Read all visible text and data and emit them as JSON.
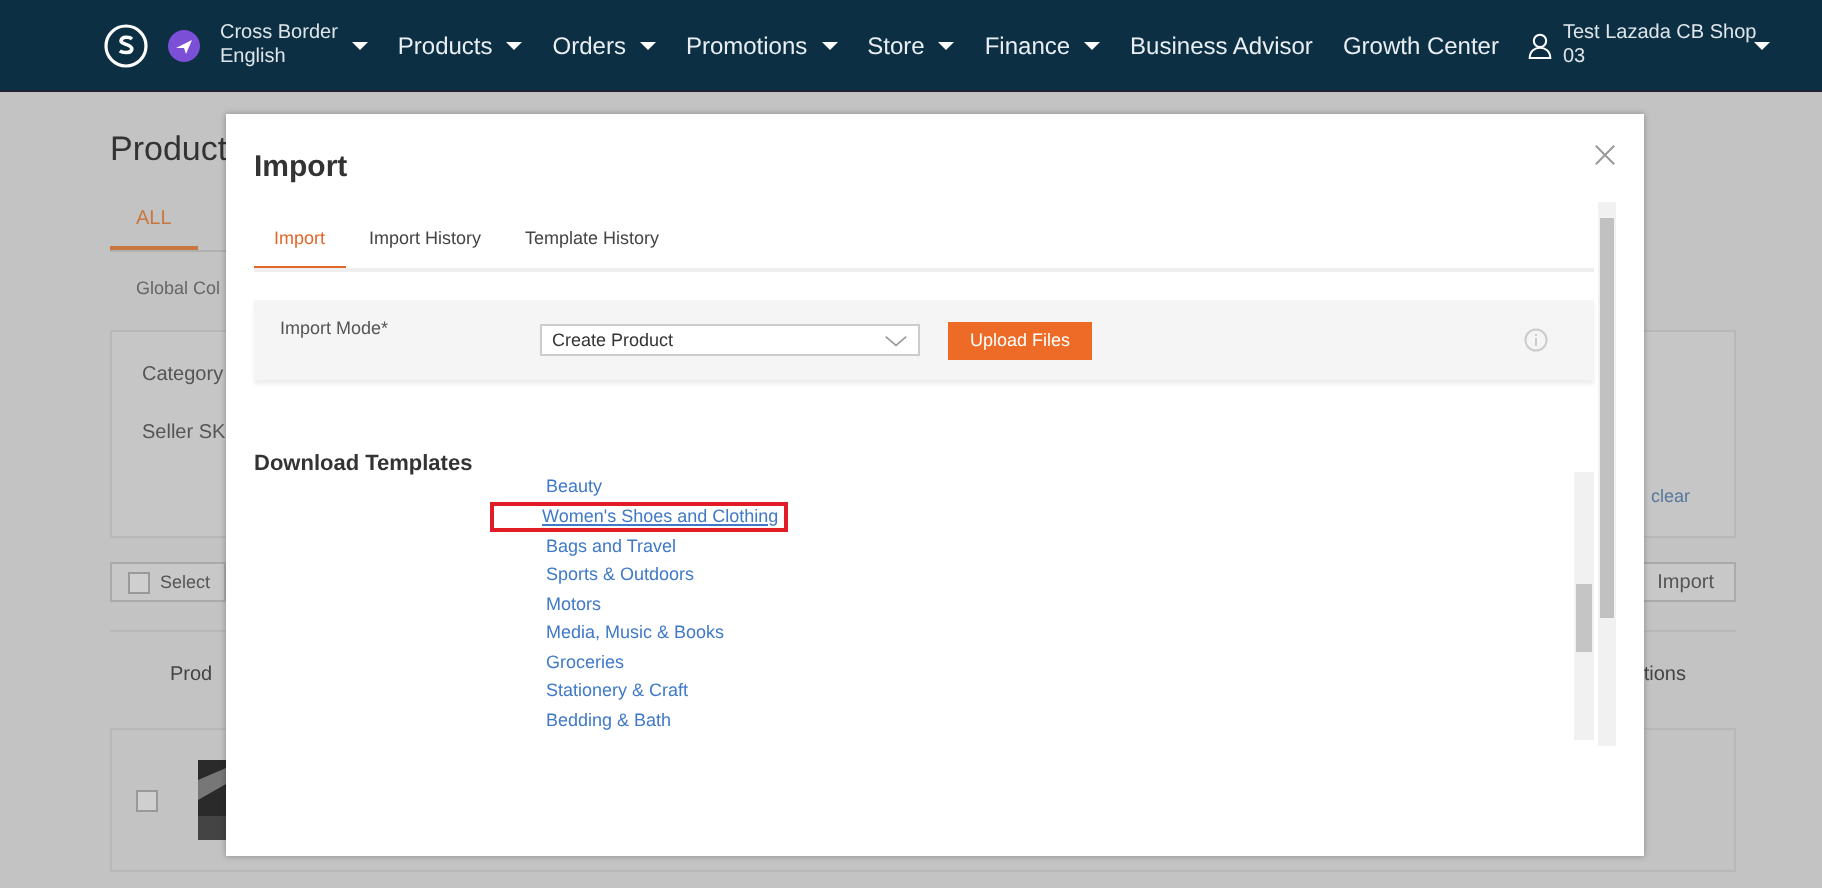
{
  "top_nav": {
    "region": {
      "line1": "Cross Border",
      "line2": "English"
    },
    "items": [
      {
        "label": "Products",
        "has_menu": true
      },
      {
        "label": "Orders",
        "has_menu": true
      },
      {
        "label": "Promotions",
        "has_menu": true
      },
      {
        "label": "Store",
        "has_menu": true
      },
      {
        "label": "Finance",
        "has_menu": true
      },
      {
        "label": "Business Advisor",
        "has_menu": false
      },
      {
        "label": "Growth Center",
        "has_menu": false
      }
    ],
    "account": {
      "line1": "Test Lazada CB Shop",
      "line2": "03"
    }
  },
  "page": {
    "title": "Product",
    "tabs": [
      {
        "label": "ALL",
        "selected": true
      }
    ],
    "subtab": "Global Col",
    "filters": [
      "Category",
      "Seller SK"
    ],
    "clear": "clear",
    "select": {
      "label": "Select",
      "checked": false
    },
    "import": "Import",
    "columns": [
      "Prod",
      "tions"
    ],
    "row": {
      "checked": false
    }
  },
  "dialog": {
    "title": "Import",
    "tabs": [
      {
        "label": "Import",
        "selected": true
      },
      {
        "label": "Import History",
        "selected": false
      },
      {
        "label": "Template History",
        "selected": false
      }
    ],
    "mode_label": "Import Mode*",
    "mode_value": "Create Product",
    "upload": "Upload Files",
    "templates_heading": "Download Templates",
    "templates": [
      {
        "label": "Beauty",
        "highlighted": false
      },
      {
        "label": "Women's Shoes and Clothing",
        "highlighted": true
      },
      {
        "label": "Bags and Travel",
        "highlighted": false
      },
      {
        "label": "Sports & Outdoors",
        "highlighted": false
      },
      {
        "label": "Motors",
        "highlighted": false
      },
      {
        "label": "Media, Music & Books",
        "highlighted": false
      },
      {
        "label": "Groceries",
        "highlighted": false
      },
      {
        "label": "Stationery & Craft",
        "highlighted": false
      },
      {
        "label": "Bedding & Bath",
        "highlighted": false
      }
    ]
  }
}
